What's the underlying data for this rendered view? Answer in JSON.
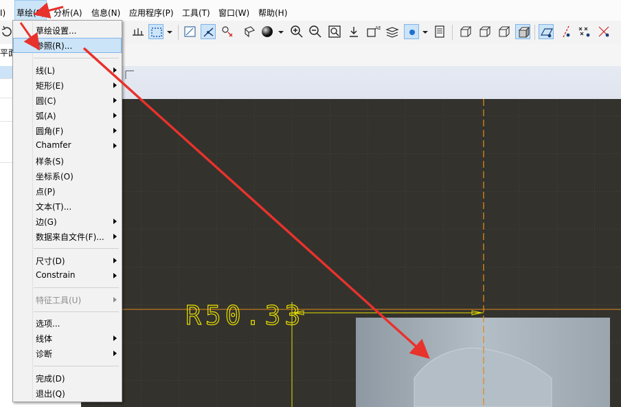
{
  "menubar": {
    "items": [
      {
        "label": "I)"
      },
      {
        "label": "草绘(S)"
      },
      {
        "label": "分析(A)"
      },
      {
        "label": "信息(N)"
      },
      {
        "label": "应用程序(P)"
      },
      {
        "label": "工具(T)"
      },
      {
        "label": "窗口(W)"
      },
      {
        "label": "帮助(H)"
      }
    ]
  },
  "left_panel": {
    "tab_label": "平面",
    "selected_row": ""
  },
  "sketch_menu": {
    "items": [
      {
        "label": "草绘设置..."
      },
      {
        "label": "参照(R)..."
      },
      {
        "label": "线(L)"
      },
      {
        "label": "矩形(E)"
      },
      {
        "label": "圆(C)"
      },
      {
        "label": "弧(A)"
      },
      {
        "label": "圆角(F)"
      },
      {
        "label": "Chamfer"
      },
      {
        "label": "样条(S)"
      },
      {
        "label": "坐标系(O)"
      },
      {
        "label": "点(P)"
      },
      {
        "label": "文本(T)..."
      },
      {
        "label": "边(G)"
      },
      {
        "label": "数据来自文件(F)..."
      },
      {
        "label": "尺寸(D)"
      },
      {
        "label": "Constrain"
      },
      {
        "label": "特征工具(U)"
      },
      {
        "label": "选项..."
      },
      {
        "label": "线体"
      },
      {
        "label": "诊断"
      },
      {
        "label": "完成(D)"
      },
      {
        "label": "退出(Q)"
      }
    ]
  },
  "canvas": {
    "dimension_text": "R50.33"
  },
  "colors": {
    "canvas_bg": "#33322d",
    "sketch_yellow": "#e8e000",
    "centerline_orange": "#e08a1a",
    "arrow_red": "#e8322c",
    "highlight": "#cce4f7",
    "part_gray": "#a9b3bc"
  },
  "icons": [
    "redo-icon",
    "sketch-tool-icon",
    "select-box-icon",
    "dropdown-arrow-icon",
    "sketcher-icon",
    "spline-icon",
    "datum-icon",
    "shading-icon",
    "zoom-in-icon",
    "zoom-out-icon",
    "refit-icon",
    "orient-icon",
    "annotation-icon",
    "layers-icon",
    "display-style-icon",
    "saved-views-icon",
    "wireframe-icon",
    "hidden-line-icon",
    "no-hidden-icon",
    "shaded-icon",
    "datum-plane-icon",
    "datum-axis-icon",
    "point-icon",
    "csys-icon"
  ]
}
